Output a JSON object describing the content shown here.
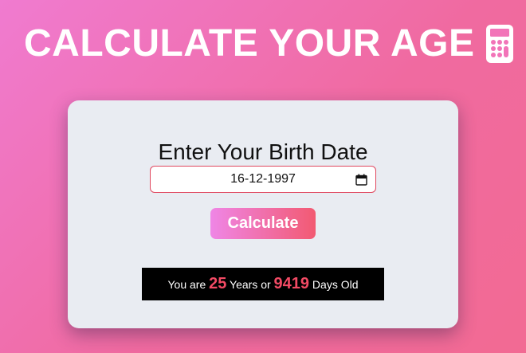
{
  "header": {
    "title": "CALCULATE YOUR AGE",
    "icon": "calculator-icon"
  },
  "card": {
    "heading": "Enter Your Birth Date",
    "birth_date": {
      "value": "16-12-1997",
      "icon": "calendar-icon"
    },
    "calculate_label": "Calculate",
    "result": {
      "prefix": "You are ",
      "years": "25",
      "years_text": " Years or ",
      "days": "9419",
      "days_text": " Days Old"
    }
  },
  "colors": {
    "background_start": "#f07bd0",
    "background_end": "#f26a93",
    "accent": "#f24a64",
    "card": "#e9ecf2"
  }
}
